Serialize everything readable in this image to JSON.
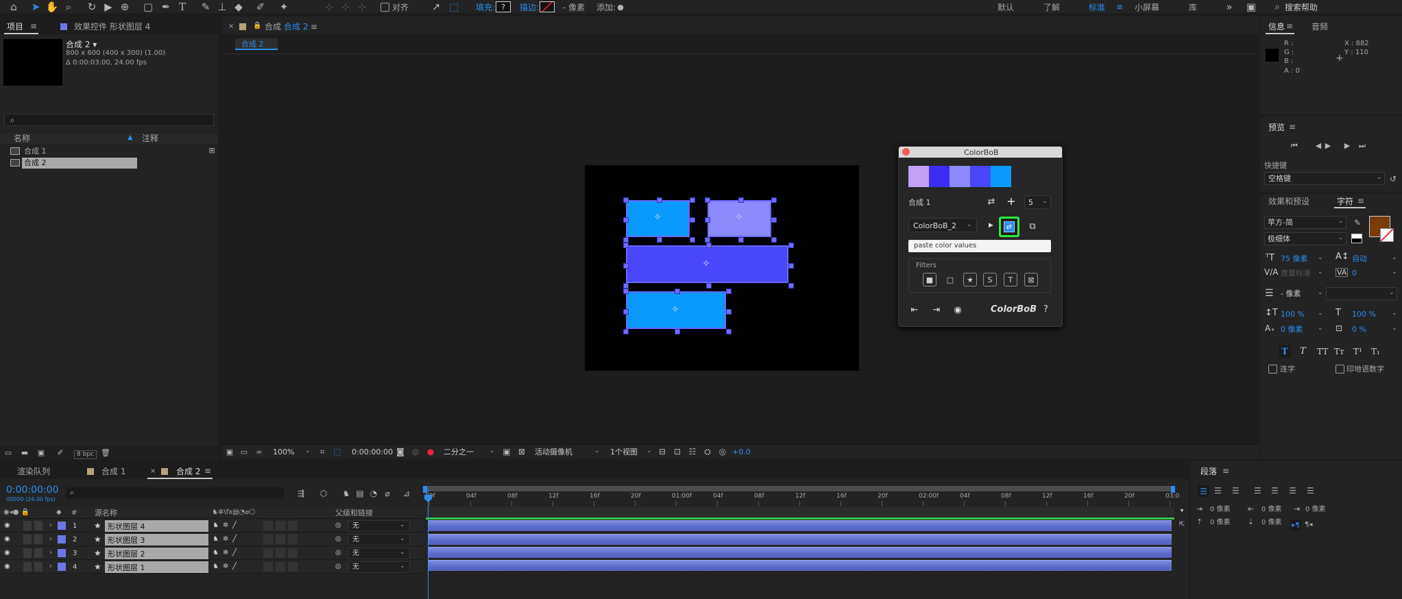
{
  "toolbar": {
    "align_label": "对齐",
    "fill_label": "填充:",
    "fill_value": "?",
    "stroke_label": "描边:",
    "pixels_label": "- 像素",
    "add_label": "添加:",
    "workspaces": [
      "默认",
      "了解",
      "标准",
      "小屏幕",
      "库"
    ],
    "active_workspace": "标准",
    "search_placeholder": "搜索帮助"
  },
  "project_panel": {
    "tab_project": "项目",
    "tab_effects": "效果控件 形状图层 4",
    "comp_name": "合成 2 ▾",
    "comp_size": "800 x 600  (400 x 300) (1.00)",
    "comp_duration": "Δ 0:00:03:00, 24.00 fps",
    "col_name": "名称",
    "col_comment": "注释",
    "items": [
      "合成 1",
      "合成 2"
    ],
    "bpc": "8 bpc"
  },
  "composition_panel": {
    "tab_label": "合成",
    "tab_name": "合成 2",
    "breadcrumb": "合成 2",
    "zoom": "100%",
    "timecode": "0:00:00:00",
    "resolution": "二分之一",
    "camera": "活动摄像机",
    "views": "1个视图",
    "exposure": "+0.0"
  },
  "colorbob": {
    "title": "ColorBoB",
    "swatches": [
      "#c3a2f4",
      "#3a2ef4",
      "#8d8afd",
      "#4a46fc",
      "#0a9aff"
    ],
    "comp_label": "合成 1",
    "count": "5",
    "preset": "ColorBoB_2",
    "paste_placeholder": "paste color values",
    "filters_label": "Filters",
    "logo": "ColorBoB",
    "help": "?"
  },
  "info_panel": {
    "tab_info": "信息",
    "tab_audio": "音频",
    "r": "R :",
    "g": "G :",
    "b": "B :",
    "a": "A : 0",
    "x": "X : 882",
    "y": "Y : 110"
  },
  "preview_panel": {
    "title": "预览",
    "shortcut_label": "快捷键",
    "shortcut_value": "空格键"
  },
  "character_panel": {
    "tab_effects": "效果和预设",
    "tab_character": "字符",
    "font": "苹方-简",
    "style": "极细体",
    "size": "75 像素",
    "leading": "自动",
    "kerning": "度量标准",
    "tracking": "0",
    "stroke_width": "- 像素",
    "vscale": "100 %",
    "hscale": "100 %",
    "baseline": "0 像素",
    "tsume": "0 %",
    "ligatures": "连字",
    "hindi": "印地语数字",
    "fill_color": "#7a3b0a"
  },
  "timeline": {
    "tab_render": "渲染队列",
    "tab_comp1": "合成 1",
    "tab_comp2": "合成 2",
    "timecode": "0:00:00:00",
    "frame_info": "00000 (24.00 fps)",
    "col_hash": "#",
    "col_source": "源名称",
    "col_parent": "父级和链接",
    "layers": [
      {
        "num": "1",
        "name": "形状图层 4",
        "parent": "无"
      },
      {
        "num": "2",
        "name": "形状图层 3",
        "parent": "无"
      },
      {
        "num": "3",
        "name": "形状图层 2",
        "parent": "无"
      },
      {
        "num": "4",
        "name": "形状图层 1",
        "parent": "无"
      }
    ],
    "ruler": [
      "00f",
      "04f",
      "08f",
      "12f",
      "16f",
      "20f",
      "01:00f",
      "04f",
      "08f",
      "12f",
      "16f",
      "20f",
      "02:00f",
      "04f",
      "08f",
      "12f",
      "16f",
      "20f",
      "03:0"
    ]
  },
  "paragraph_panel": {
    "title": "段落",
    "indent1": "0 像素",
    "indent2": "0 像素",
    "indent3": "0 像素",
    "indent4": "0 像素",
    "indent5": "0 像素"
  }
}
